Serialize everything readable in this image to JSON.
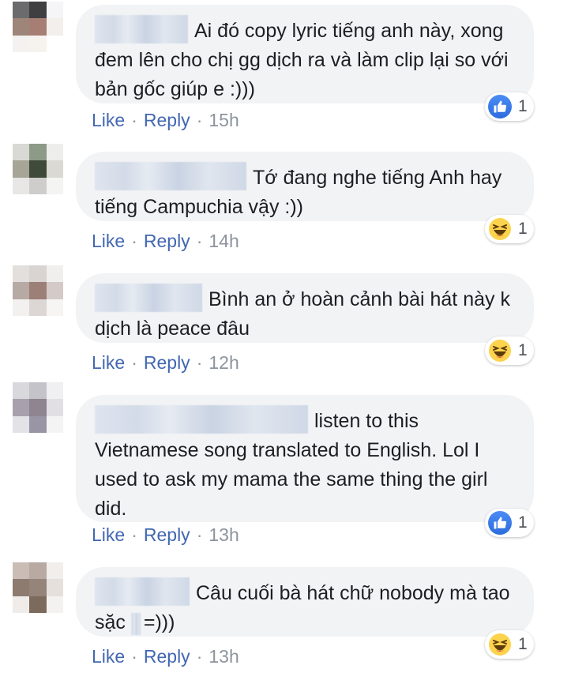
{
  "comments": [
    {
      "text": "Ai đó copy lyric tiếng anh này, xong đem lên cho chị gg dịch ra và làm clip lại so với bản gốc giúp e :)))",
      "reaction_icon": "like-icon",
      "reaction_count": "1",
      "like_label": "Like",
      "reply_label": "Reply",
      "time": "15h",
      "avatar_colors": [
        "#6b6b6d",
        "#3f3f42",
        "#f5f5f7",
        "#9d8579",
        "#a77e74",
        "#f2efec",
        "#f4f2f0",
        "#f6f3ee",
        "#ffffff"
      ]
    },
    {
      "text": "Tớ đang nghe tiếng Anh hay tiếng Campuchia vậy :))",
      "reaction_icon": "haha-icon",
      "reaction_count": "1",
      "like_label": "Like",
      "reply_label": "Reply",
      "time": "14h",
      "avatar_colors": [
        "#d8d8d4",
        "#8e9a88",
        "#ededeb",
        "#a7a596",
        "#3f4a3a",
        "#dbd9d3",
        "#e9e7e5",
        "#cfcdcb",
        "#f4f4f3"
      ]
    },
    {
      "text": "Bình an ở hoàn cảnh bài hát này k dịch là peace đâu",
      "reaction_icon": "haha-icon",
      "reaction_count": "1",
      "like_label": "Like",
      "reply_label": "Reply",
      "time": "12h",
      "avatar_colors": [
        "#e2dfdd",
        "#d9d3d1",
        "#f1efee",
        "#b7a9a4",
        "#9c7f77",
        "#d4cbc8",
        "#f3f1f0",
        "#dcd6d4",
        "#f6f5f4"
      ]
    },
    {
      "text": "listen to this Vietnamese song translated to English. Lol I used to ask my mama the same thing the girl did.",
      "reaction_icon": "like-icon",
      "reaction_count": "1",
      "like_label": "Like",
      "reply_label": "Reply",
      "time": "13h",
      "avatar_colors": [
        "#d9d8dc",
        "#c5c3ca",
        "#f0eff1",
        "#a8a1ad",
        "#8e8591",
        "#e1dfe3",
        "#e3e2e6",
        "#9a95a4",
        "#f4f4f5"
      ]
    },
    {
      "text": "Câu cuối bà hát chữ nobody mà tao sặc ",
      "text_tail": "=)))",
      "reaction_icon": "haha-icon",
      "reaction_count": "1",
      "like_label": "Like",
      "reply_label": "Reply",
      "time": "13h",
      "avatar_colors": [
        "#c9bdb5",
        "#b8aaa2",
        "#f1eeec",
        "#8d7b70",
        "#94847a",
        "#e6e0dc",
        "#efece9",
        "#7c6a5d",
        "#f4f2f0"
      ]
    }
  ]
}
